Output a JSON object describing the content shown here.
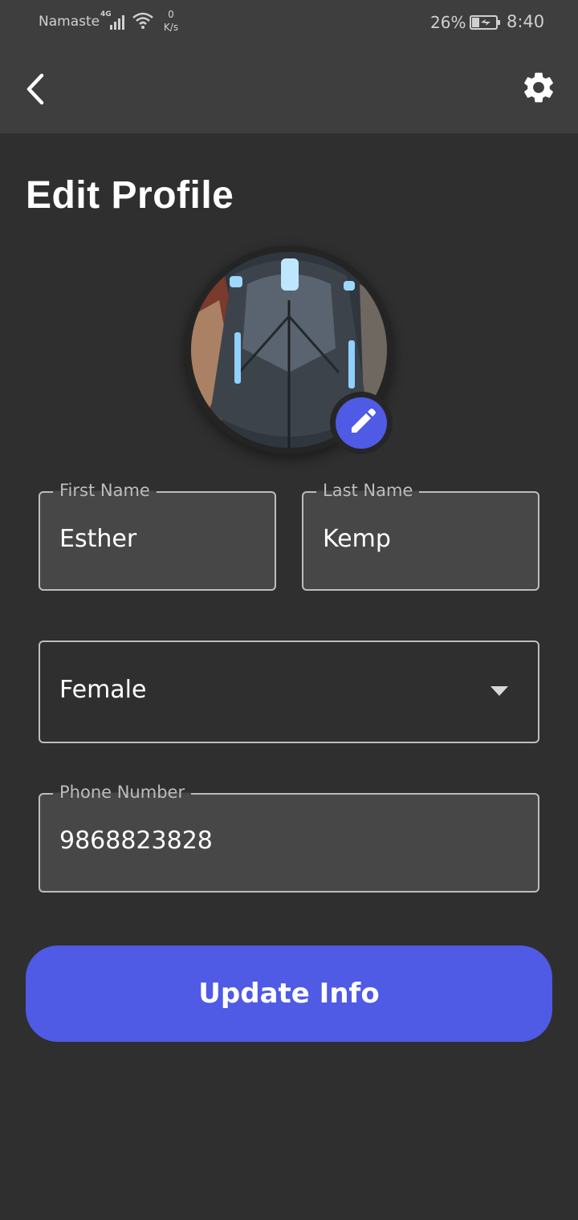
{
  "status_bar": {
    "carrier": "Namaste",
    "network": "4G",
    "speed_value": "0",
    "speed_unit": "K/s",
    "battery_percent": "26%",
    "time": "8:40"
  },
  "app_bar": {
    "back_icon": "chevron-left-icon",
    "settings_icon": "gear-icon"
  },
  "page": {
    "title": "Edit Profile"
  },
  "avatar": {
    "edit_icon": "pencil-icon"
  },
  "form": {
    "first_name_label": "First Name",
    "first_name_value": "Esther",
    "last_name_label": "Last Name",
    "last_name_value": "Kemp",
    "gender_value": "Female",
    "phone_label": "Phone Number",
    "phone_value": "9868823828"
  },
  "actions": {
    "update_label": "Update Info"
  },
  "colors": {
    "background": "#2f2f2f",
    "app_bar": "#3e3e3e",
    "accent": "#4f5ae5",
    "field_fill": "#474747",
    "field_border": "#bdbdbd"
  }
}
